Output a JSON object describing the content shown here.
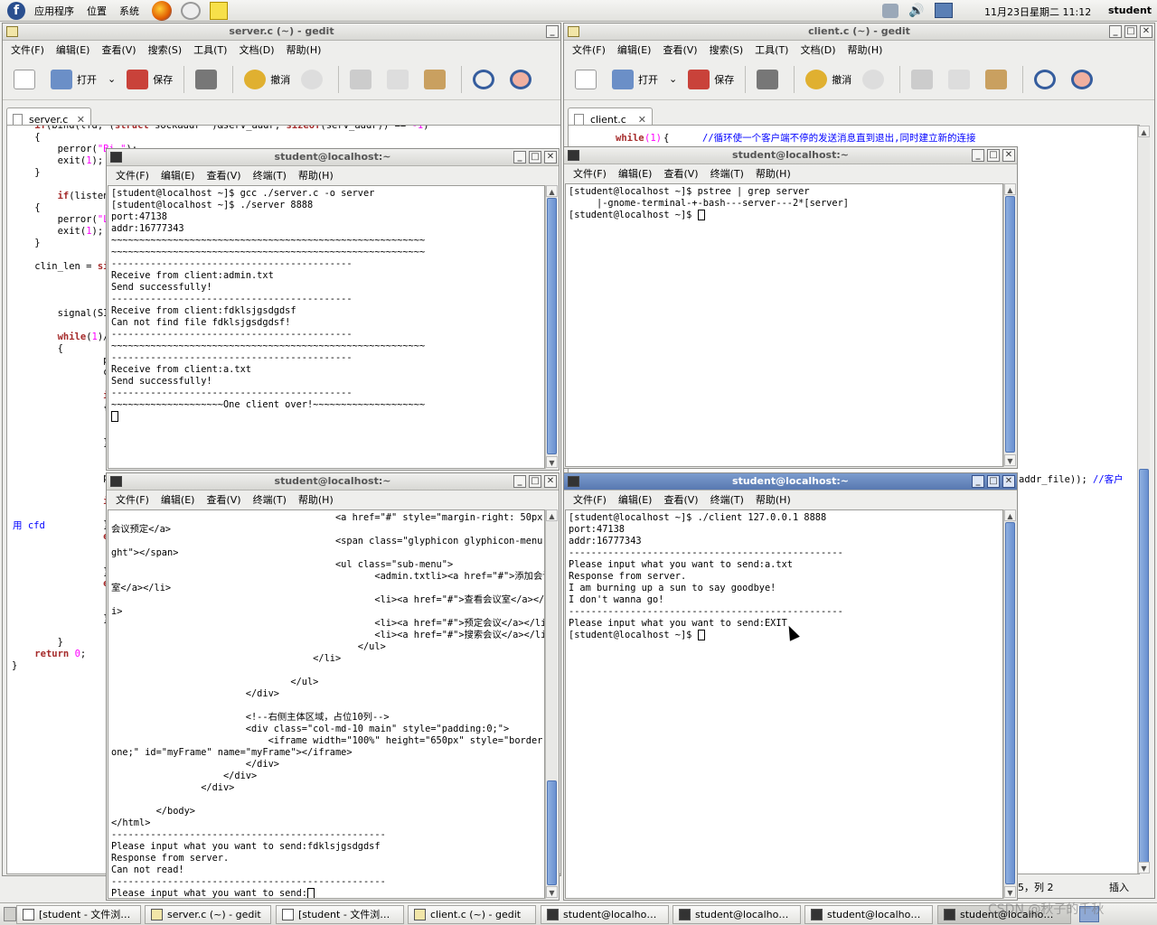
{
  "top_panel": {
    "menus": [
      "应用程序",
      "位置",
      "系统"
    ],
    "datetime": "11月23日星期二 11:12",
    "user": "student"
  },
  "gedit_left": {
    "title": "server.c (~) - gedit",
    "menus": [
      "文件(F)",
      "编辑(E)",
      "查看(V)",
      "搜索(S)",
      "工具(T)",
      "文档(D)",
      "帮助(H)"
    ],
    "toolbar": {
      "open": "打开",
      "save": "保存",
      "undo": "撤消"
    },
    "tab": "server.c",
    "side_text": "用 cfd"
  },
  "gedit_right": {
    "title": "client.c (~) - gedit",
    "menus": [
      "文件(F)",
      "编辑(E)",
      "查看(V)",
      "搜索(S)",
      "工具(T)",
      "文档(D)",
      "帮助(H)"
    ],
    "toolbar": {
      "open": "打开",
      "save": "保存",
      "undo": "撤消"
    },
    "tab": "client.c",
    "top_code_kw": "while",
    "top_code_num": "(1)",
    "top_code_comment": "//循环使一个客户端不停的发送消息直到退出,同时建立新的连接",
    "side_code": "addr_file));",
    "side_comment": "//客户",
    "status_pos": "5，列 2",
    "status_mode": "插入"
  },
  "term_menus": [
    "文件(F)",
    "编辑(E)",
    "查看(V)",
    "终端(T)",
    "帮助(H)"
  ],
  "term_server": {
    "title": "student@localhost:~",
    "lines": [
      "[student@localhost ~]$ gcc ./server.c -o server",
      "[student@localhost ~]$ ./server 8888",
      "port:47138",
      "addr:16777343",
      "~~~~~~~~~~~~~~~~~~~~~~~~~~~~~~~~~~~~~~~~~~~~~~~~~~~~~~~~",
      "~~~~~~~~~~~~~~~~~~~~~~~~~~~~~~~~~~~~~~~~~~~~~~~~~~~~~~~~",
      "-------------------------------------------",
      "Receive from client:admin.txt",
      "Send successfully!",
      "-------------------------------------------",
      "Receive from client:fdklsjgsdgdsf",
      "Can not find file fdklsjgsdgdsf!",
      "-------------------------------------------",
      "~~~~~~~~~~~~~~~~~~~~~~~~~~~~~~~~~~~~~~~~~~~~~~~~~~~~~~~~",
      "-------------------------------------------",
      "Receive from client:a.txt",
      "Send successfully!",
      "-------------------------------------------",
      "~~~~~~~~~~~~~~~~~~~~One client over!~~~~~~~~~~~~~~~~~~~~"
    ]
  },
  "term_pstree": {
    "title": "student@localhost:~",
    "lines": [
      "[student@localhost ~]$ pstree | grep server",
      "     |-gnome-terminal-+-bash---server---2*[server]",
      "[student@localhost ~]$ "
    ]
  },
  "term_client1": {
    "title": "student@localhost:~",
    "lines": [
      "                                        <a href=\"#\" style=\"margin-right: 50px;\">",
      "会议预定</a>",
      "                                        <span class=\"glyphicon glyphicon-menu-ri",
      "ght\"></span>",
      "                                        <ul class=\"sub-menu\">",
      "                                               <admin.txtli><a href=\"#\">添加会议",
      "室</a></li>",
      "                                               <li><a href=\"#\">查看会议室</a></l",
      "i>",
      "                                               <li><a href=\"#\">预定会议</a></li>",
      "                                               <li><a href=\"#\">搜索会议</a></li>",
      "                                            </ul>",
      "                                    </li>",
      "",
      "                                </ul>",
      "                        </div>",
      "",
      "                        <!--右侧主体区域，占位10列-->",
      "                        <div class=\"col-md-10 main\" style=\"padding:0;\">",
      "                            <iframe width=\"100%\" height=\"650px\" style=\"border: n",
      "one;\" id=\"myFrame\" name=\"myFrame\"></iframe>",
      "                        </div>",
      "                    </div>",
      "                </div>",
      "",
      "        </body>",
      "</html>",
      "-------------------------------------------------",
      "Please input what you want to send:fdklsjgsdgdsf",
      "Response from server.",
      "Can not read!",
      "-------------------------------------------------",
      "Please input what you want to send:"
    ]
  },
  "term_client2": {
    "title": "student@localhost:~",
    "lines": [
      "[student@localhost ~]$ ./client 127.0.0.1 8888",
      "port:47138",
      "addr:16777343",
      "-------------------------------------------------",
      "Please input what you want to send:a.txt",
      "Response from server.",
      "I am burning up a sun to say goodbye!",
      "I don't wanna go!",
      "-------------------------------------------------",
      "Please input what you want to send:EXIT",
      "[student@localhost ~]$ "
    ]
  },
  "taskbar": [
    "[student - 文件浏…",
    "server.c (~) - gedit",
    "[student - 文件浏…",
    "client.c (~) - gedit",
    "student@localho…",
    "student@localho…",
    "student@localho…",
    "student@localho…"
  ],
  "watermark": "CSDN @秋子的千秋"
}
